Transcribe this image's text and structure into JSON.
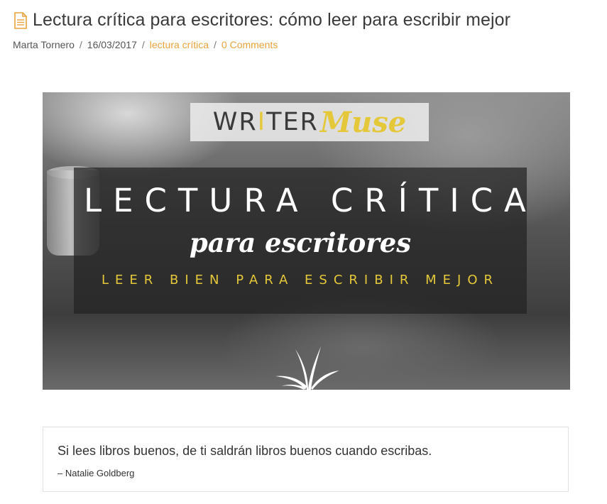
{
  "post": {
    "title": "Lectura crítica para escritores: cómo leer para escribir mejor",
    "icon": "document-icon",
    "accent_color": "#e8a33d",
    "meta": {
      "author": "Marta Tornero",
      "date": "16/03/2017",
      "category": "lectura crítica",
      "comments": "0 Comments",
      "separator": "/"
    }
  },
  "hero": {
    "logo_writer_prefix": "WR",
    "logo_writer_i": "I",
    "logo_writer_suffix": "TER",
    "logo_muse": "Muse",
    "heading": "LECTURA CRÍTICA",
    "subheading": "para escritores",
    "tagline": "LEER BIEN PARA ESCRIBIR MEJOR",
    "logo_accent": "#e4c83a"
  },
  "quote": {
    "text": "Si lees libros buenos, de ti saldrán libros buenos cuando escribas.",
    "author": "– Natalie Goldberg"
  }
}
